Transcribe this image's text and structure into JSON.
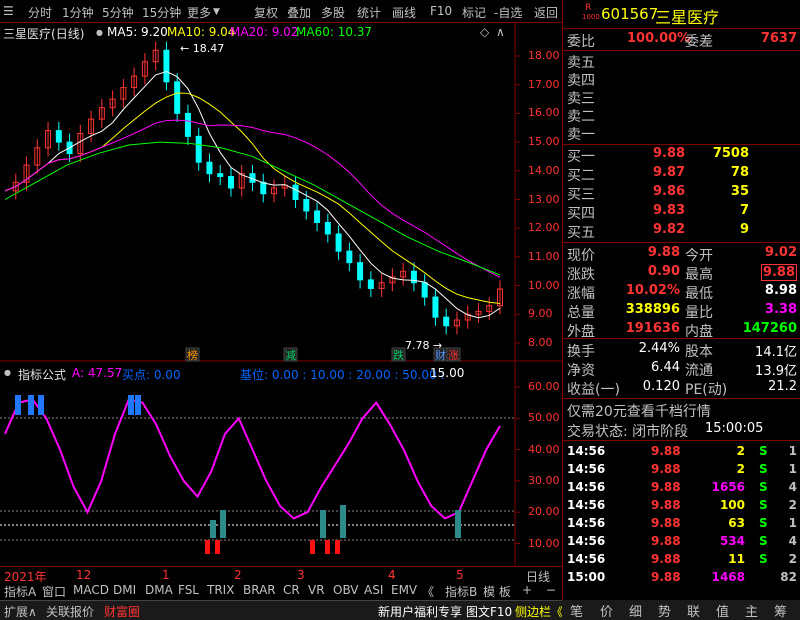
{
  "toolbar": {
    "periods": [
      "分时",
      "1分钟",
      "5分钟",
      "15分钟",
      "更多"
    ],
    "tools": [
      "复权",
      "叠加",
      "多股",
      "统计",
      "画线",
      "F10",
      "标记",
      "-自选",
      "返回"
    ]
  },
  "chart": {
    "title": "三星医疗",
    "period": "(日线)",
    "ma": [
      {
        "label": "MA5: 9.20",
        "color": "#ffffff"
      },
      {
        "label": "MA10: 9.04",
        "color": "#ffff00"
      },
      {
        "label": "MA20: 9.02",
        "color": "#ff00ff"
      },
      {
        "label": "MA60: 10.37",
        "color": "#00ff00"
      }
    ],
    "high_label": "18.47",
    "low_label": "7.78",
    "yaxis": [
      "18.00",
      "17.00",
      "16.00",
      "15.00",
      "14.00",
      "13.00",
      "12.00",
      "11.00",
      "10.00",
      "9.00",
      "8.00"
    ],
    "markers": [
      "榜",
      "减",
      "跌",
      "财",
      "涨"
    ]
  },
  "indicator": {
    "name": "指标公式",
    "a_label": "A: 47.57",
    "buy_label": "买点: 0.00",
    "level_label": "基位: 0.00 : 10.00 : 20.00 : 50.00 :",
    "level_end": "15.00",
    "yaxis": [
      "60.00",
      "50.00",
      "40.00",
      "30.00",
      "20.00",
      "10.00"
    ]
  },
  "xaxis": {
    "labels": [
      "2021年",
      "12",
      "1",
      "2",
      "3",
      "4",
      "5"
    ],
    "period": "日线"
  },
  "tabs": [
    "指标A",
    "窗口",
    "MACD",
    "DMI",
    "DMA",
    "FSL",
    "TRIX",
    "BRAR",
    "CR",
    "VR",
    "OBV",
    "ASI",
    "EMV",
    "《",
    "指标B",
    "模 板",
    "+",
    "−"
  ],
  "bottom": {
    "left": [
      "扩展∧",
      "关联报价",
      "财富圈"
    ],
    "promo": "新用户福利专享",
    "f10": "图文F10",
    "side": "侧边栏《"
  },
  "quote": {
    "code": "601567",
    "name": "三星医疗",
    "rmark": "R",
    "weibi_l": "委比",
    "weibi": "100.00%",
    "weicha_l": "委差",
    "weicha": "7637",
    "sell": [
      {
        "l": "卖五"
      },
      {
        "l": "卖四"
      },
      {
        "l": "卖三"
      },
      {
        "l": "卖二"
      },
      {
        "l": "卖一"
      }
    ],
    "buy": [
      {
        "l": "买一",
        "p": "9.88",
        "v": "7508"
      },
      {
        "l": "买二",
        "p": "9.87",
        "v": "78"
      },
      {
        "l": "买三",
        "p": "9.86",
        "v": "35"
      },
      {
        "l": "买四",
        "p": "9.83",
        "v": "7"
      },
      {
        "l": "买五",
        "p": "9.82",
        "v": "9"
      }
    ],
    "stats": [
      {
        "a": "现价",
        "av": "9.88",
        "b": "今开",
        "bv": "9.02"
      },
      {
        "a": "涨跌",
        "av": "0.90",
        "b": "最高",
        "bv": "9.88"
      },
      {
        "a": "涨幅",
        "av": "10.02%",
        "b": "最低",
        "bv": "8.98"
      },
      {
        "a": "总量",
        "av": "338896",
        "b": "量比",
        "bv": "3.38"
      },
      {
        "a": "外盘",
        "av": "191636",
        "b": "内盘",
        "bv": "147260"
      }
    ],
    "stats2": [
      {
        "a": "换手",
        "av": "2.44%",
        "b": "股本",
        "bv": "14.1亿"
      },
      {
        "a": "净资",
        "av": "6.44",
        "b": "流通",
        "bv": "13.9亿"
      },
      {
        "a": "收益(一)",
        "av": "0.120",
        "b": "PE(动)",
        "bv": "21.2"
      }
    ],
    "promo": "仅需20元查看千档行情",
    "status_l": "交易状态: 闭市阶段",
    "status_t": "15:00:05",
    "ticks": [
      {
        "t": "14:56",
        "p": "9.88",
        "v": "2",
        "s": "S",
        "n": "1"
      },
      {
        "t": "14:56",
        "p": "9.88",
        "v": "2",
        "s": "S",
        "n": "1"
      },
      {
        "t": "14:56",
        "p": "9.88",
        "v": "1656",
        "s": "S",
        "n": "4"
      },
      {
        "t": "14:56",
        "p": "9.88",
        "v": "100",
        "s": "S",
        "n": "2"
      },
      {
        "t": "14:56",
        "p": "9.88",
        "v": "63",
        "s": "S",
        "n": "1"
      },
      {
        "t": "14:56",
        "p": "9.88",
        "v": "534",
        "s": "S",
        "n": "4"
      },
      {
        "t": "14:56",
        "p": "9.88",
        "v": "11",
        "s": "S",
        "n": "2"
      },
      {
        "t": "15:00",
        "p": "9.88",
        "v": "1468",
        "s": "",
        "n": "82"
      }
    ],
    "rtabs": [
      "笔",
      "价",
      "细",
      "势",
      "联",
      "值",
      "主",
      "筹"
    ]
  },
  "colors": {
    "up": "#ff3333",
    "down": "#00ffff",
    "ma5": "#ffffff",
    "ma10": "#ffff00",
    "ma20": "#ff00ff",
    "ma60": "#00ff00",
    "grid": "#800000"
  }
}
